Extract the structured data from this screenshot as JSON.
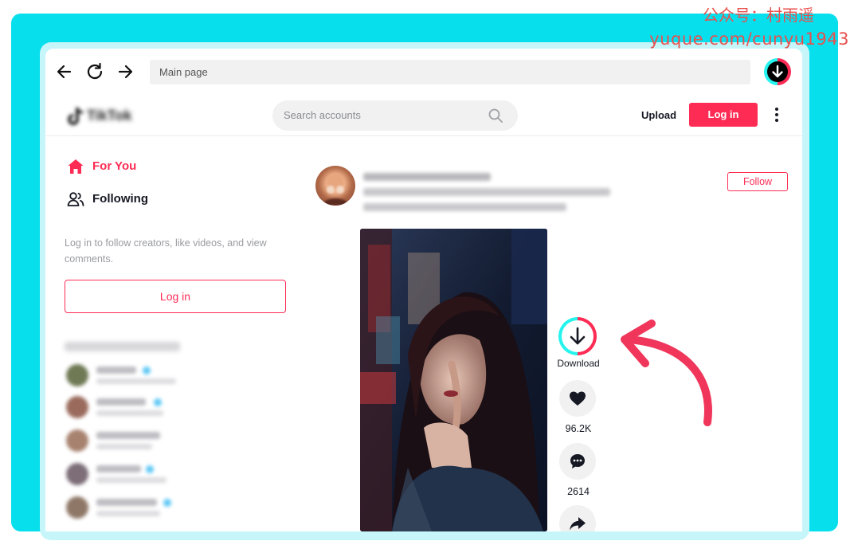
{
  "watermark": {
    "line1": "公众号：村雨遥",
    "line2": "yuque.com/cunyu1943"
  },
  "browser": {
    "address": "Main page",
    "icons": {
      "back": "arrow-left-icon",
      "reload": "reload-icon",
      "forward": "arrow-right-icon",
      "extension": "download-extension-icon"
    }
  },
  "header": {
    "logo": "TikTok",
    "search_placeholder": "Search accounts",
    "upload_label": "Upload",
    "login_label": "Log in"
  },
  "sidebar": {
    "items": [
      {
        "label": "For You",
        "icon": "home-icon",
        "active": true
      },
      {
        "label": "Following",
        "icon": "users-icon",
        "active": false
      }
    ],
    "login_prompt": "Log in to follow creators, like videos, and view comments.",
    "login_button": "Log in"
  },
  "post": {
    "follow_label": "Follow",
    "download_label": "Download",
    "likes": "96.2K",
    "comments": "2614"
  },
  "colors": {
    "accent": "#fe2c55",
    "cyan": "#25f4ee",
    "frame": "#07dfed"
  }
}
